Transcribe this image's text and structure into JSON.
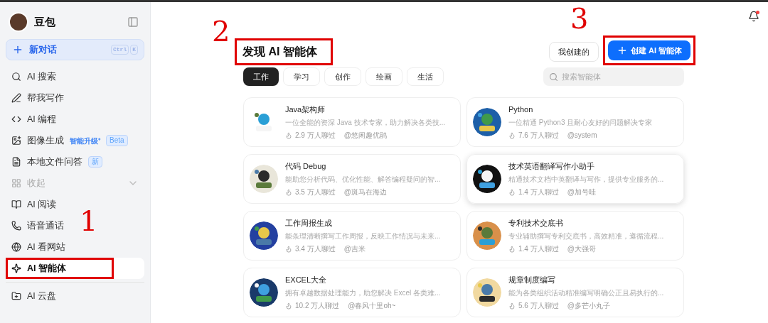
{
  "sidebar": {
    "brand": "豆包",
    "new_chat": {
      "label": "新对话",
      "shortcut": [
        "Ctrl",
        "K"
      ]
    },
    "items": [
      {
        "kind": "link",
        "label": "AI 搜索",
        "selected": false
      },
      {
        "kind": "link",
        "label": "帮我写作",
        "selected": false
      },
      {
        "kind": "link",
        "label": "AI 编程",
        "selected": false
      },
      {
        "kind": "link",
        "label": "图像生成",
        "tag": "智能升级⁺",
        "badge": "Beta",
        "selected": false
      },
      {
        "kind": "link",
        "label": "本地文件问答",
        "badge": "新",
        "selected": false
      },
      {
        "kind": "collapse",
        "label": "收起",
        "selected": false
      },
      {
        "kind": "link",
        "label": "AI 阅读",
        "selected": false
      },
      {
        "kind": "link",
        "label": "语音通话",
        "selected": false
      },
      {
        "kind": "link",
        "label": "AI 看网站",
        "selected": false
      },
      {
        "kind": "link",
        "label": "AI 智能体",
        "selected": true
      },
      {
        "kind": "divider"
      },
      {
        "kind": "link",
        "label": "AI 云盘",
        "selected": false
      }
    ]
  },
  "main": {
    "title": "发现 AI 智能体",
    "my_created": "我创建的",
    "create_button": "创建 AI 智能体",
    "tabs": [
      {
        "label": "工作",
        "selected": true
      },
      {
        "label": "学习",
        "selected": false
      },
      {
        "label": "创作",
        "selected": false
      },
      {
        "label": "绘画",
        "selected": false
      },
      {
        "label": "生活",
        "selected": false
      }
    ],
    "search": {
      "placeholder": "搜索智能体"
    },
    "agents": [
      {
        "name": "Java架构师",
        "description": "一位全能的资深 Java 技术专家，助力解决各类技...",
        "chats": "2.9 万人聊过",
        "author": "@悠闲趣优鹃",
        "highlighted": false
      },
      {
        "name": "Python",
        "description": "一位精通 Python3 且耐心友好的问题解决专家",
        "chats": "7.6 万人聊过",
        "author": "@system",
        "highlighted": false
      },
      {
        "name": "代码 Debug",
        "description": "能助您分析代码、优化性能、解答编程疑问的智...",
        "chats": "3.5 万人聊过",
        "author": "@斑马在海边",
        "highlighted": false
      },
      {
        "name": "技术英语翻译写作小助手",
        "description": "精通技术文档中英翻译与写作，提供专业服务的...",
        "chats": "1.4 万人聊过",
        "author": "@加号哇",
        "highlighted": true
      },
      {
        "name": "工作周报生成",
        "description": "能条理清晰撰写工作周报，反映工作情况与未来...",
        "chats": "3.4 万人聊过",
        "author": "@吉米",
        "highlighted": false
      },
      {
        "name": "专利技术交底书",
        "description": "专业辅助撰写专利交底书，高效精准，遵循流程...",
        "chats": "1.4 万人聊过",
        "author": "@大强哥",
        "highlighted": false
      },
      {
        "name": "EXCEL大全",
        "description": "拥有卓越数据处理能力，助您解决 Excel 各类难...",
        "chats": "10.2 万人聊过",
        "author": "@春风十里oh~",
        "highlighted": false
      },
      {
        "name": "规章制度编写",
        "description": "能为各类组织活动精准编写明确公正且易执行的...",
        "chats": "5.6 万人聊过",
        "author": "@多芒小丸子",
        "highlighted": false
      }
    ]
  },
  "annotations": [
    "1",
    "2",
    "3"
  ]
}
